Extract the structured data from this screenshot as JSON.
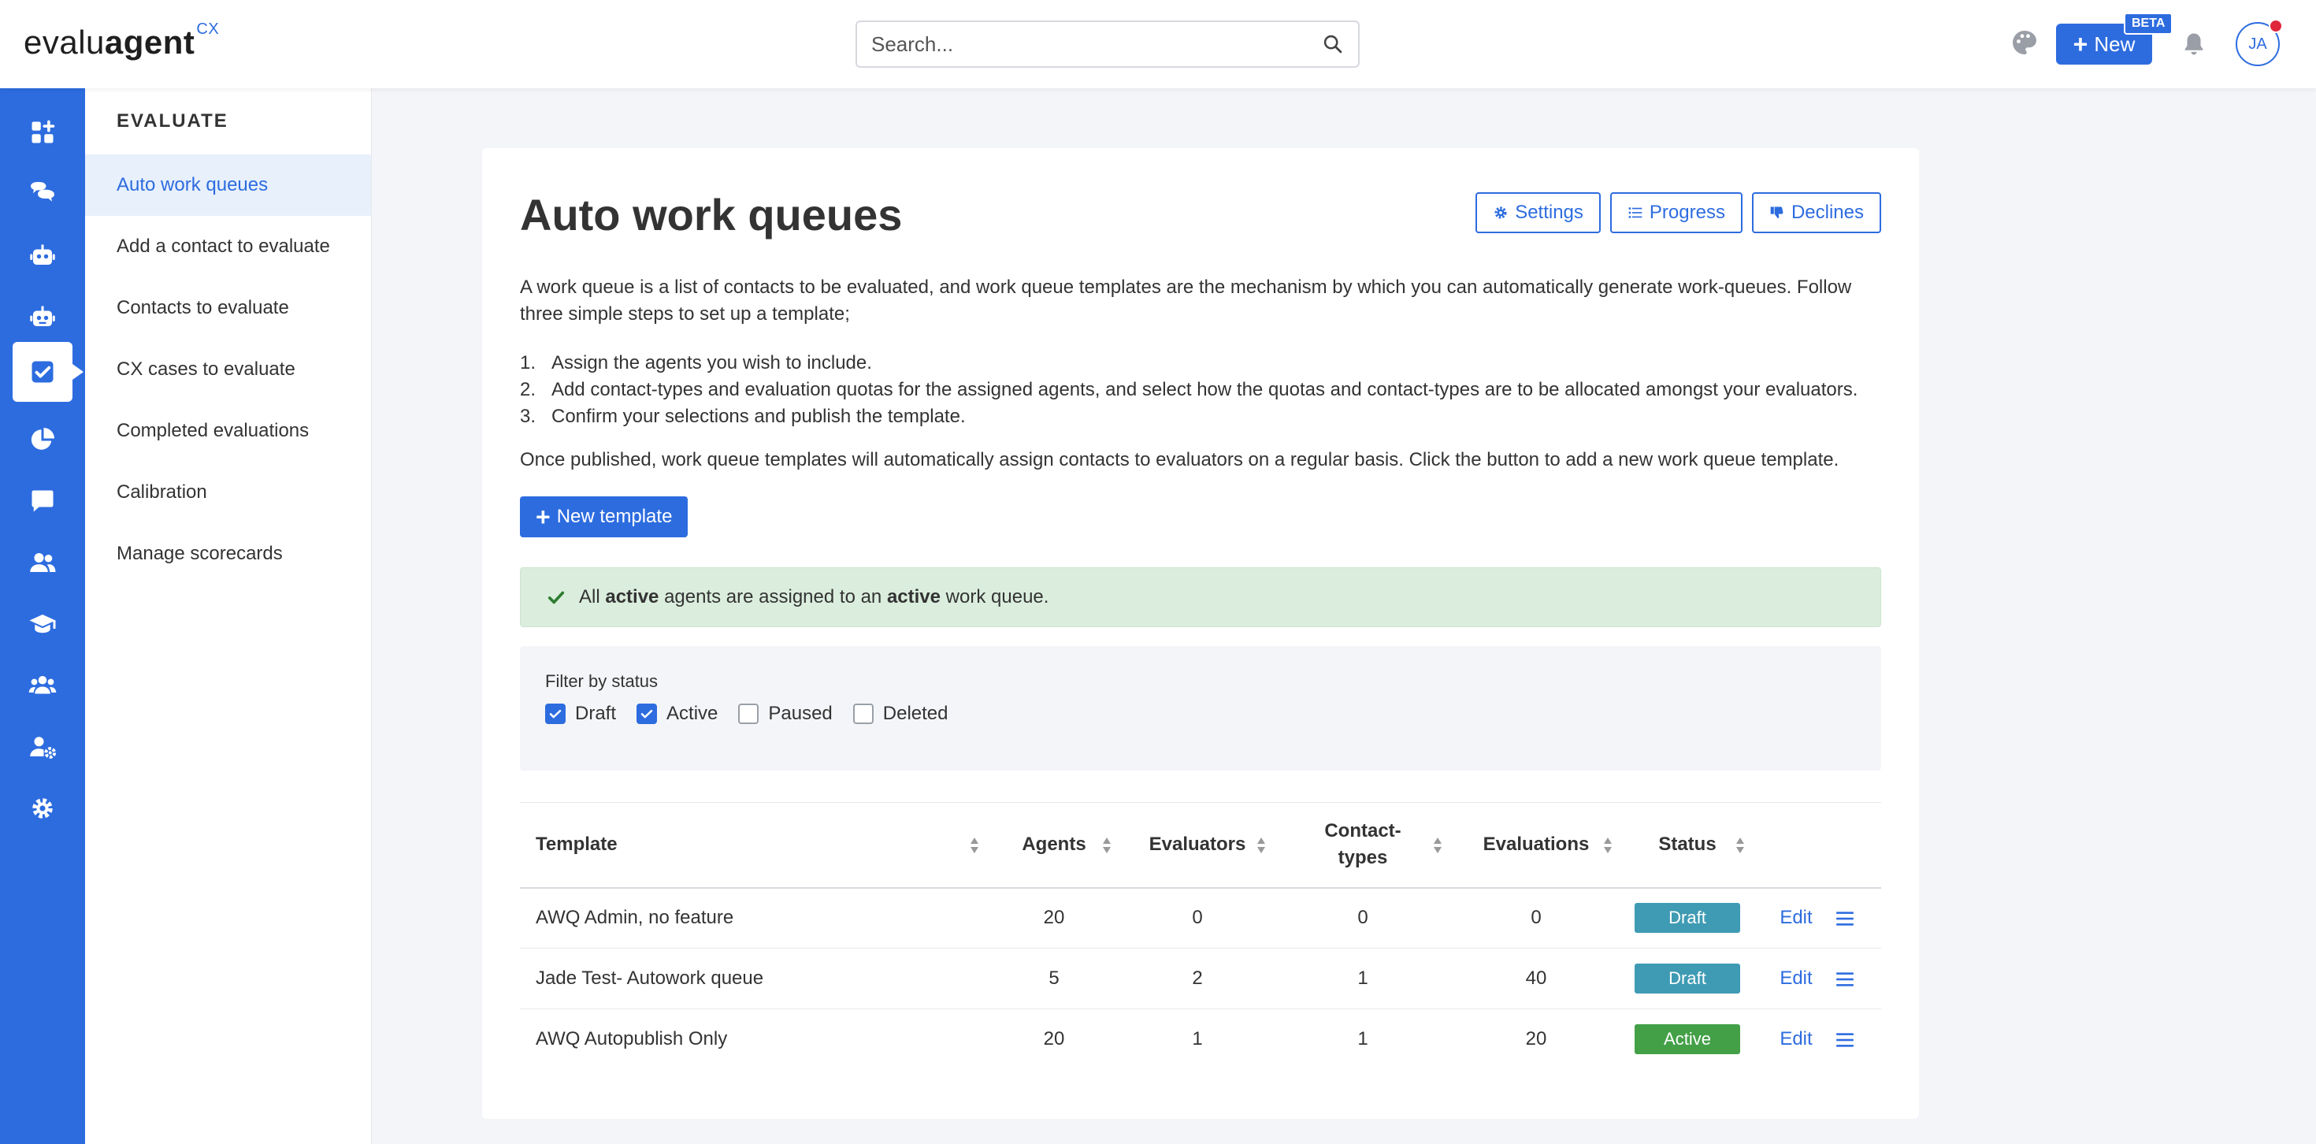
{
  "topbar": {
    "logo_a": "evalu",
    "logo_b": "agent",
    "logo_sup": "CX",
    "search_placeholder": "Search...",
    "new_label": "New",
    "beta_label": "BETA",
    "avatar_initials": "JA"
  },
  "rail": {
    "icons": [
      "dashboard-add-icon",
      "chat-bubbles-icon",
      "robot-icon",
      "robot-alt-icon",
      "checkbox-icon",
      "pie-chart-icon",
      "comment-icon",
      "users-icon",
      "graduation-cap-icon",
      "team-icon",
      "user-settings-icon",
      "gear-icon"
    ],
    "active_index": 4
  },
  "submenu": {
    "heading": "EVALUATE",
    "items": [
      {
        "label": "Auto work queues",
        "active": true
      },
      {
        "label": "Add a contact to evaluate"
      },
      {
        "label": "Contacts to evaluate"
      },
      {
        "label": "CX cases to evaluate"
      },
      {
        "label": "Completed evaluations"
      },
      {
        "label": "Calibration"
      },
      {
        "label": "Manage scorecards"
      }
    ]
  },
  "main": {
    "title": "Auto work queues",
    "buttons": {
      "settings": "Settings",
      "progress": "Progress",
      "declines": "Declines"
    },
    "description": "A work queue is a list of contacts to be evaluated, and work queue templates are the mechanism by which you can automatically generate work-queues. Follow three simple steps to set up a template;",
    "steps": [
      "Assign the agents you wish to include.",
      "Add contact-types and evaluation quotas for the assigned agents, and select how the quotas and contact-types are to be allocated amongst your evaluators.",
      "Confirm your selections and publish the template."
    ],
    "step_numbers": [
      "1.",
      "2.",
      "3."
    ],
    "description2": "Once published, work queue templates will automatically assign contacts to evaluators on a regular basis. Click the button to add a new work queue template.",
    "new_template": "New template",
    "alert": {
      "p1": "All ",
      "b1": "active",
      "p2": " agents are assigned to an ",
      "b2": "active",
      "p3": " work queue."
    },
    "filter": {
      "label": "Filter by status",
      "options": [
        {
          "label": "Draft",
          "checked": true
        },
        {
          "label": "Active",
          "checked": true
        },
        {
          "label": "Paused",
          "checked": false
        },
        {
          "label": "Deleted",
          "checked": false
        }
      ]
    },
    "table": {
      "headers": [
        "Template",
        "Agents",
        "Evaluators",
        "Contact-types",
        "Evaluations",
        "Status"
      ],
      "edit_label": "Edit",
      "rows": [
        {
          "template": "AWQ Admin, no feature",
          "agents": "20",
          "evaluators": "0",
          "contact_types": "0",
          "evaluations": "0",
          "status": "Draft"
        },
        {
          "template": "Jade Test- Autowork queue",
          "agents": "5",
          "evaluators": "2",
          "contact_types": "1",
          "evaluations": "40",
          "status": "Draft"
        },
        {
          "template": "AWQ Autopublish Only",
          "agents": "20",
          "evaluators": "1",
          "contact_types": "1",
          "evaluations": "20",
          "status": "Active"
        }
      ]
    }
  },
  "colors": {
    "primary": "#2d6cdf",
    "draft": "#3f9bb3",
    "active": "#43a047",
    "alert_bg": "#dbeedd",
    "check_green": "#2e7d32"
  }
}
